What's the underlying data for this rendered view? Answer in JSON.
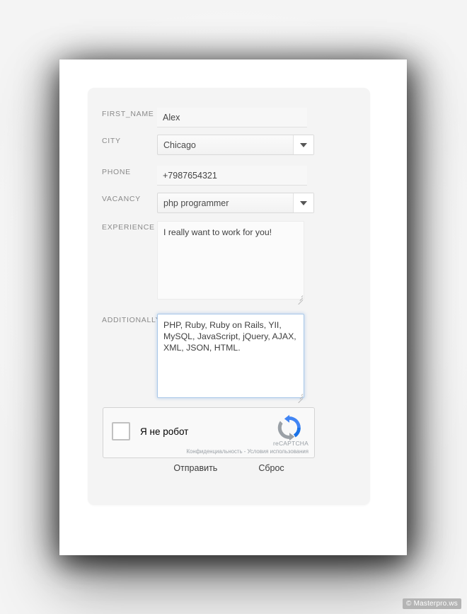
{
  "form": {
    "fields": [
      {
        "label": "FIRST_NAME",
        "type": "text",
        "value": "Alex",
        "placeholder": ""
      },
      {
        "label": "CITY",
        "type": "select",
        "value": "Chicago",
        "placeholder": ""
      },
      {
        "label": "PHONE",
        "type": "text",
        "value": "+7987654321",
        "placeholder": ""
      },
      {
        "label": "VACANCY",
        "type": "select",
        "value": "php programmer",
        "placeholder": ""
      },
      {
        "label": "EXPERIENCE",
        "type": "textarea",
        "value": "I really want to work for you!",
        "placeholder": ""
      },
      {
        "label": "ADDITIONALLY",
        "type": "textarea",
        "value": "PHP, Ruby, Ruby on Rails, YII, MySQL, JavaScript, jQuery, AJAX, XML, JSON, HTML.",
        "placeholder": "",
        "focused": true
      }
    ]
  },
  "captcha": {
    "checkbox_label": "Я не робот",
    "brand": "reCAPTCHA",
    "privacy": "Конфиденциальность",
    "separator": "-",
    "terms": "Условия использования",
    "terms_line": "Конфиденциальность - Условия использования",
    "logo_blue": "#4285f4",
    "logo_dark_blue": "#1a73e8",
    "logo_gray": "#9aa0a6"
  },
  "actions": {
    "submit_label": "Отправить",
    "reset_label": "Сброс"
  },
  "watermark": {
    "text": "© Masterpro.ws"
  },
  "colors": {
    "panel_bg": "#f4f4f4",
    "page_bg": "#ffffff",
    "label": "#8a8a8a",
    "focus_border": "#a9c7e8"
  }
}
